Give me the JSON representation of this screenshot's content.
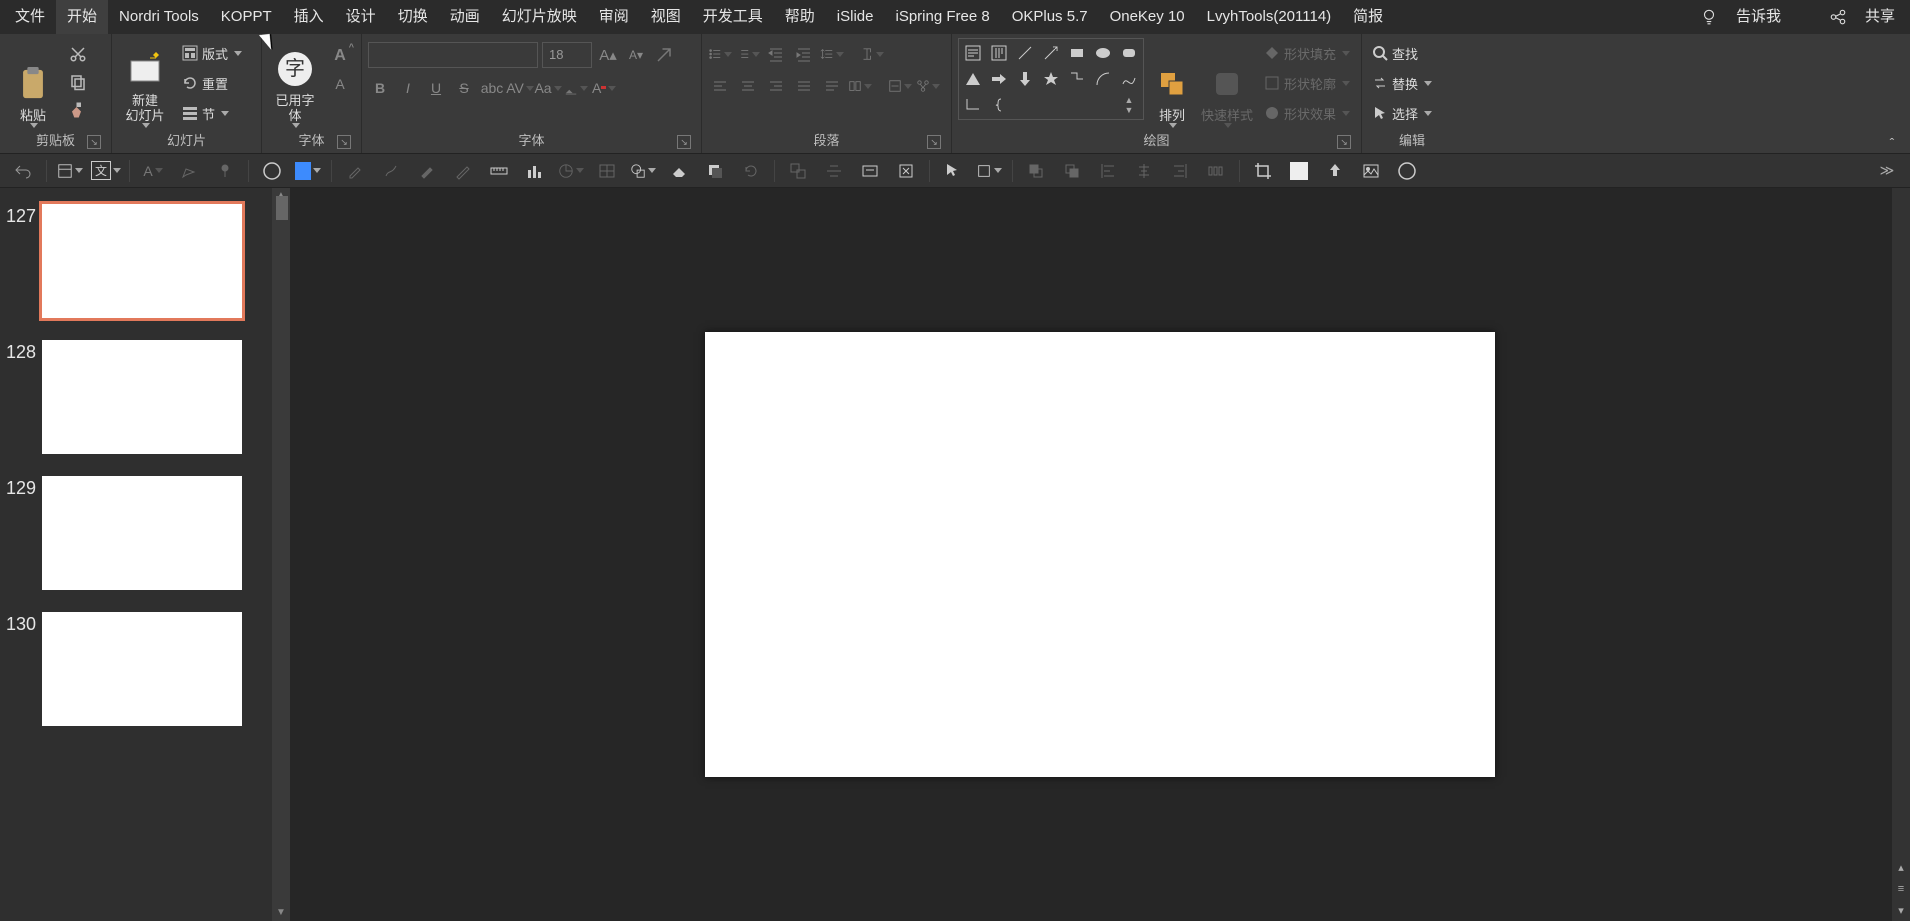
{
  "menu": {
    "tabs": [
      "文件",
      "开始",
      "Nordri Tools",
      "KOPPT",
      "插入",
      "设计",
      "切换",
      "动画",
      "幻灯片放映",
      "审阅",
      "视图",
      "开发工具",
      "帮助",
      "iSlide",
      "iSpring Free 8",
      "OKPlus 5.7",
      "OneKey 10",
      "LvyhTools(201114)",
      "简报"
    ],
    "active_index": 1,
    "tell_me": "告诉我",
    "share": "共享"
  },
  "ribbon": {
    "clipboard": {
      "paste": "粘贴",
      "label": "剪贴板"
    },
    "slides": {
      "new_slide": "新建\n幻灯片",
      "layout": "版式",
      "reset": "重置",
      "section": "节",
      "label": "幻灯片"
    },
    "usedfont": {
      "btn": "已用字\n体",
      "label": "字体"
    },
    "font": {
      "size": "18",
      "label": "字体"
    },
    "para": {
      "label": "段落"
    },
    "drawing": {
      "arrange": "排列",
      "quickstyle": "快速样式",
      "fill": "形状填充",
      "outline": "形状轮廓",
      "effects": "形状效果",
      "label": "绘图"
    },
    "editing": {
      "find": "查找",
      "replace": "替换",
      "select": "选择",
      "label": "编辑"
    }
  },
  "thumbs": {
    "items": [
      {
        "num": "127",
        "selected": true
      },
      {
        "num": "128",
        "selected": false
      },
      {
        "num": "129",
        "selected": false
      },
      {
        "num": "130",
        "selected": false
      }
    ]
  }
}
